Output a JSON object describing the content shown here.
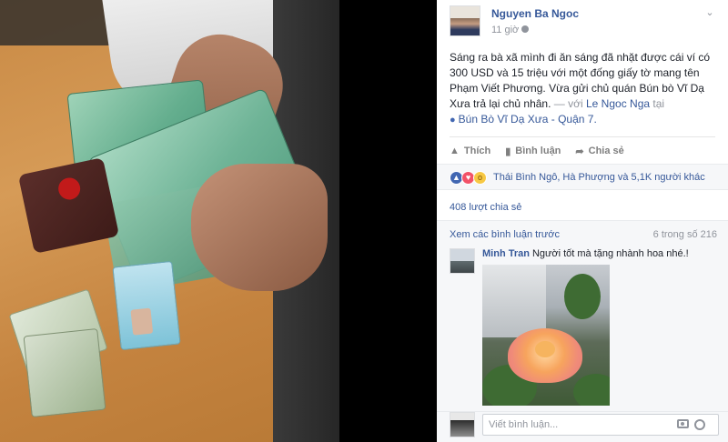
{
  "post": {
    "author": "Nguyen Ba Ngoc",
    "time": "11 giờ",
    "text_main": "Sáng ra bà xã mình đi ăn sáng đã nhặt được cái ví có 300 USD và 15 triệu với một đống giấy tờ mang tên Phạm Viết Phương. Vừa gửi chủ quán Bún bò Vĩ Dạ Xưa trả lại chủ nhân.",
    "with_text": "— với",
    "tagged_person": "Le Ngoc Nga",
    "at_text": "tại",
    "place": "Bún Bò Vĩ Dạ Xưa - Quận 7."
  },
  "actions": {
    "like": "Thích",
    "comment": "Bình luận",
    "share": "Chia sẻ"
  },
  "reactions": {
    "summary": "Thái Bình Ngô, Hà Phượng và 5,1K người khác"
  },
  "shares_text": "408 lượt chia sẻ",
  "comments": {
    "view_previous": "Xem các bình luận trước",
    "count_text": "6 trong số 216",
    "items": [
      {
        "name": "Minh Tran",
        "text": "Người tốt mà tặng nhành hoa nhé.!"
      }
    ]
  },
  "reply": {
    "placeholder": "Viết bình luận..."
  },
  "colors": {
    "link_blue": "#365899",
    "like_blue": "#4267b2",
    "love_red": "#f25268",
    "wow_yellow": "#f7c843"
  }
}
